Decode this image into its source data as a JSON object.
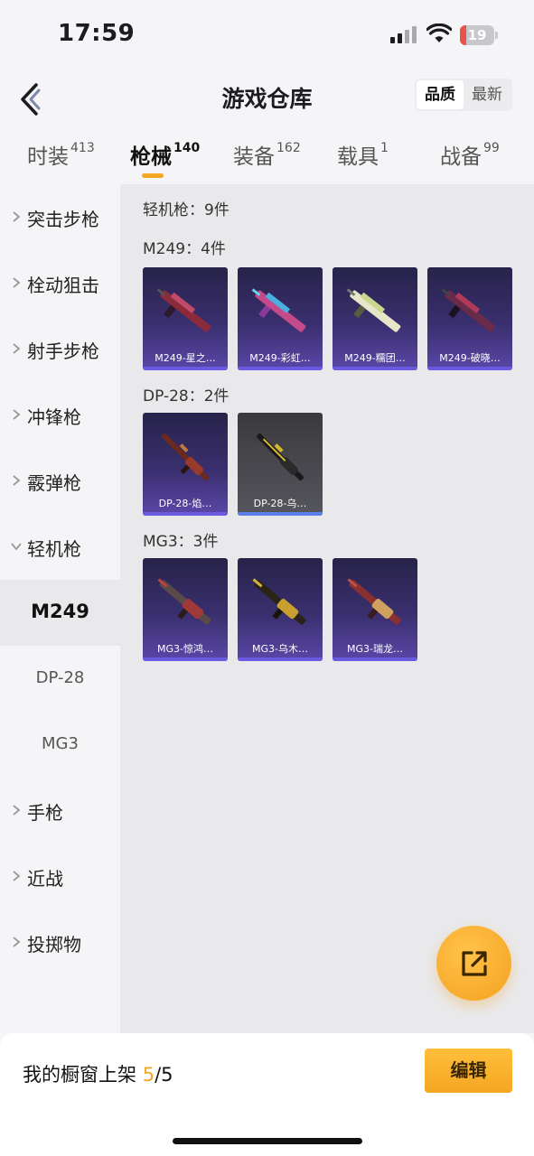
{
  "status_bar": {
    "time": "17:59",
    "battery": "19",
    "battery_level": 0.19
  },
  "header": {
    "title": "游戏仓库",
    "sort_options": [
      "品质",
      "最新"
    ],
    "sort_selected": "品质"
  },
  "tabs": [
    {
      "label": "时装",
      "count": "413"
    },
    {
      "label": "枪械",
      "count": "140",
      "active": true
    },
    {
      "label": "装备",
      "count": "162"
    },
    {
      "label": "载具",
      "count": "1"
    },
    {
      "label": "战备",
      "count": "99"
    }
  ],
  "sidebar": {
    "items": [
      {
        "label": "突击步枪"
      },
      {
        "label": "栓动狙击"
      },
      {
        "label": "射手步枪"
      },
      {
        "label": "冲锋枪"
      },
      {
        "label": "霰弹枪"
      },
      {
        "label": "轻机枪",
        "expanded": true
      },
      {
        "label": "手枪"
      },
      {
        "label": "近战"
      },
      {
        "label": "投掷物"
      }
    ],
    "sub_items": [
      {
        "label": "M249",
        "active": true
      },
      {
        "label": "DP-28"
      },
      {
        "label": "MG3"
      }
    ]
  },
  "content": {
    "summary": "轻机枪：9件",
    "groups": [
      {
        "title": "M249：4件",
        "items": [
          "M249-星之…",
          "M249-彩虹…",
          "M249-糯团…",
          "M249-破晓…"
        ]
      },
      {
        "title": "DP-28：2件",
        "items": [
          "DP-28-焰…",
          "DP-28-乌…"
        ]
      },
      {
        "title": "MG3：3件",
        "items": [
          "MG3-惊鸿…",
          "MG3-乌木…",
          "MG3-瑞龙…"
        ]
      }
    ]
  },
  "bottom": {
    "showcase_label": "我的橱窗上架 ",
    "showcase_current": "5",
    "showcase_total": "/5",
    "edit_label": "编辑"
  },
  "colors": {
    "accent": "#f5a623",
    "card_purple": "#3a2f6e",
    "card_grey": "#4a4a50"
  }
}
